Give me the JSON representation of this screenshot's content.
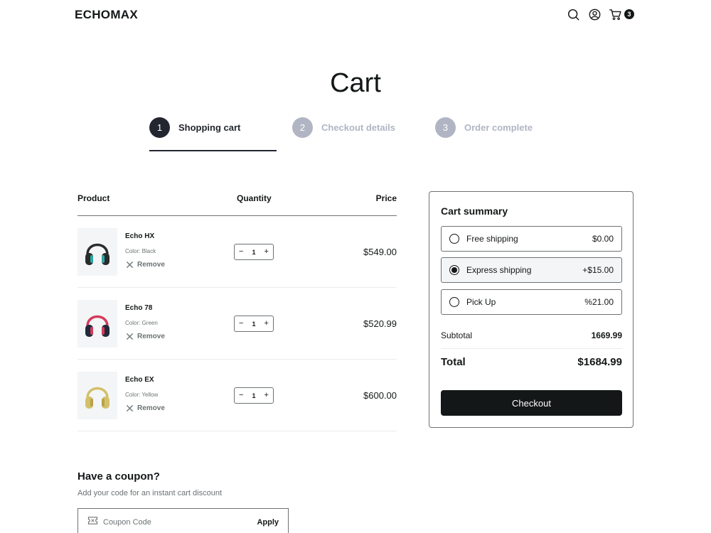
{
  "header": {
    "logo": "ECHOMAX",
    "icons": [
      "search-icon",
      "user-icon",
      "cart-icon"
    ],
    "cart_count": "3"
  },
  "page": {
    "title": "Cart"
  },
  "steps": [
    {
      "number": "1",
      "label": "Shopping cart",
      "state": "active"
    },
    {
      "number": "2",
      "label": "Checkout details",
      "state": "inactive"
    },
    {
      "number": "3",
      "label": "Order complete",
      "state": "inactive"
    }
  ],
  "table": {
    "headers": {
      "product": "Product",
      "quantity": "Quantity",
      "price": "Price"
    },
    "remove_label": "Remove",
    "items": [
      {
        "name": "Echo HX",
        "color": "Color: Black",
        "quantity": "1",
        "price": "$549.00",
        "headphone_color": "#2b2b2b",
        "accent": "#2aa9a4"
      },
      {
        "name": "Echo 78",
        "color": "Color: Green",
        "quantity": "1",
        "price": "$520.99",
        "headphone_color": "#1f2a3a",
        "accent": "#d63a5a"
      },
      {
        "name": "Echo EX",
        "color": "Color: Yellow",
        "quantity": "1",
        "price": "$600.00",
        "headphone_color": "#d4c06a",
        "accent": "#b8a24a"
      }
    ]
  },
  "summary": {
    "title": "Cart summary",
    "shipping_options": [
      {
        "label": "Free shipping",
        "price": "$0.00",
        "selected": false
      },
      {
        "label": "Express shipping",
        "price": "+$15.00",
        "selected": true
      },
      {
        "label": "Pick Up",
        "price": "%21.00",
        "selected": false
      }
    ],
    "subtotal_label": "Subtotal",
    "subtotal_value": "1669.99",
    "total_label": "Total",
    "total_value": "$1684.99",
    "checkout_label": "Checkout"
  },
  "coupon": {
    "title": "Have a coupon?",
    "subtitle": "Add your code for an instant cart discount",
    "placeholder": "Coupon Code",
    "apply_label": "Apply"
  },
  "colors": {
    "primary": "#141718",
    "step_active": "#23262f",
    "step_inactive": "#b1b5c3",
    "muted_text": "#6c7275",
    "thumb_bg": "#f3f5f7"
  }
}
